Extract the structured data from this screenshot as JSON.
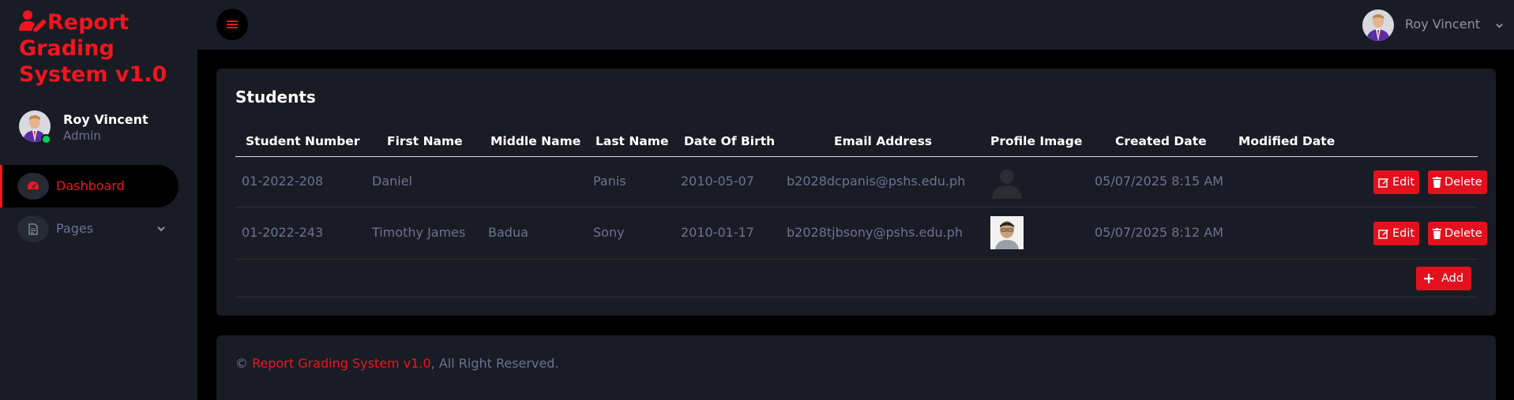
{
  "brand": {
    "title": "Report Grading System v1.0",
    "icon": "user-edit-icon",
    "color": "#f0151f"
  },
  "sidebar": {
    "profile": {
      "name": "Roy Vincent",
      "role": "Admin",
      "status": "online"
    },
    "items": [
      {
        "label": "Dashboard",
        "icon": "tachometer-icon",
        "active": true
      },
      {
        "label": "Pages",
        "icon": "file-icon",
        "expandable": true
      }
    ]
  },
  "topbar": {
    "menu_icon": "hamburger-icon",
    "user_name": "Roy Vincent"
  },
  "students": {
    "title": "Students",
    "columns": [
      "Student Number",
      "First Name",
      "Middle Name",
      "Last Name",
      "Date Of Birth",
      "Email Address",
      "Profile Image",
      "Created Date",
      "Modified Date"
    ],
    "rows": [
      {
        "student_number": "01-2022-208",
        "first_name": "Daniel",
        "middle_name": "",
        "last_name": "Panis",
        "date_of_birth": "2010-05-07",
        "email": "b2028dcpanis@pshs.edu.ph",
        "profile_image": "default-avatar-icon",
        "created_date": "05/07/2025 8:15 AM",
        "modified_date": ""
      },
      {
        "student_number": "01-2022-243",
        "first_name": "Timothy James",
        "middle_name": "Badua",
        "last_name": "Sony",
        "date_of_birth": "2010-01-17",
        "email": "b2028tjbsony@pshs.edu.ph",
        "profile_image": "student-photo",
        "created_date": "05/07/2025 8:12 AM",
        "modified_date": ""
      }
    ],
    "edit_label": "Edit",
    "delete_label": "Delete",
    "add_label": "Add"
  },
  "footer": {
    "prefix": "© ",
    "link_text": "Report Grading System v1.0",
    "suffix": ", All Right Reserved."
  },
  "colors": {
    "accent": "#f0151f",
    "button": "#e4101d",
    "panel": "#191c24",
    "background": "#000000",
    "online": "#00d25b"
  }
}
